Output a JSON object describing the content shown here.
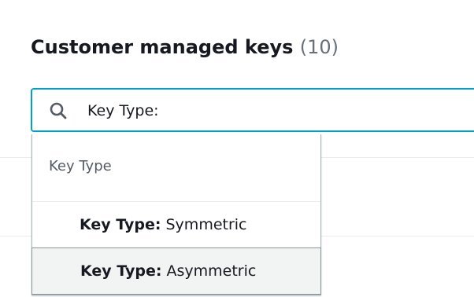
{
  "header": {
    "title": "Customer managed keys",
    "count": "(10)"
  },
  "search": {
    "value": "Key Type:",
    "icon": "search-icon"
  },
  "dropdown": {
    "group_label": "Key Type",
    "options": [
      {
        "prefix": "Key Type:",
        "value": "Symmetric",
        "highlighted": false
      },
      {
        "prefix": "Key Type:",
        "value": "Asymmetric",
        "highlighted": true
      }
    ]
  },
  "colors": {
    "accent_border": "#00a1c9",
    "title_text": "#16191f",
    "count_text": "#687078",
    "group_text": "#545b64",
    "highlight_bg": "#f2f3f3"
  }
}
